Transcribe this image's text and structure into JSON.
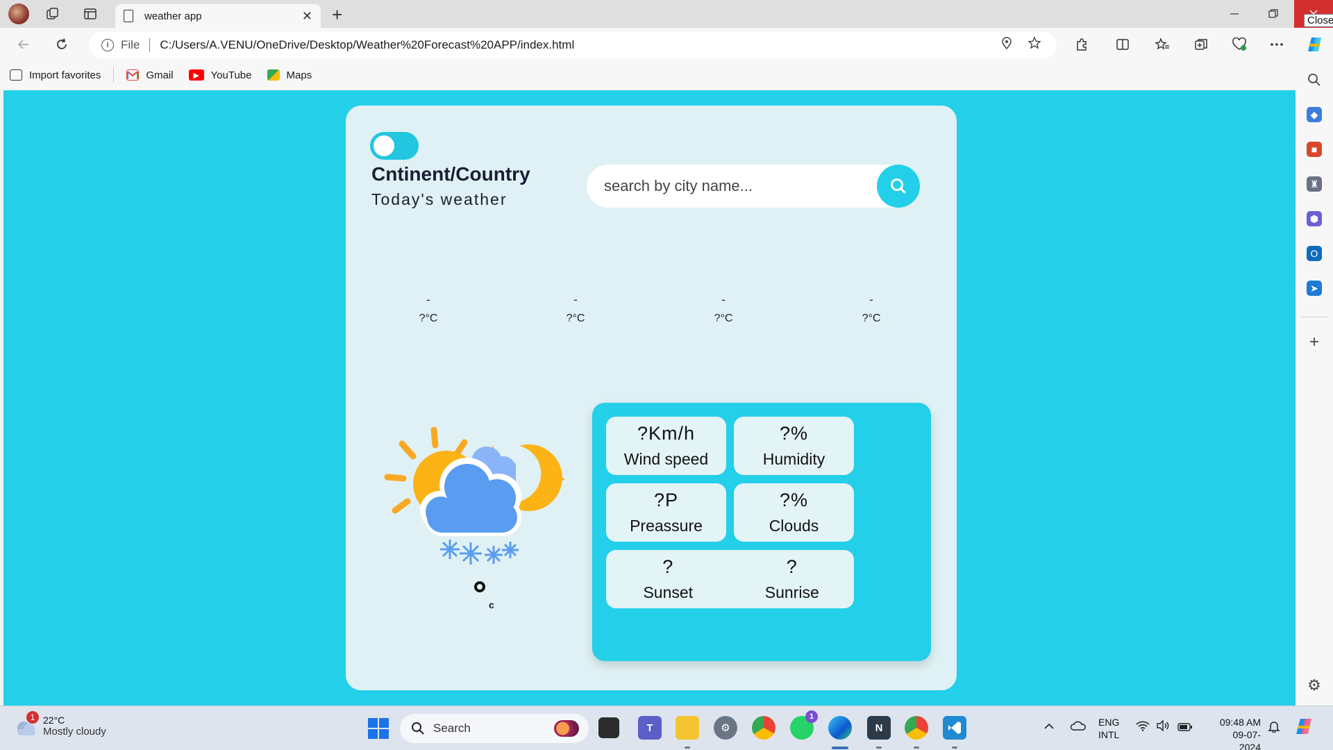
{
  "browser": {
    "tab_title": "weather app",
    "tab_close": "✕",
    "new_tab": "+",
    "file_label": "File",
    "url": "C:/Users/A.VENU/OneDrive/Desktop/Weather%20Forecast%20APP/index.html",
    "close_tooltip": "Close",
    "favorites": [
      {
        "label": "Import favorites",
        "icon": "import-icon"
      },
      {
        "label": "Gmail",
        "icon": "gmail-icon",
        "color": "#ea4335"
      },
      {
        "label": "YouTube",
        "icon": "youtube-icon",
        "color": "#ff0000"
      },
      {
        "label": "Maps",
        "icon": "maps-icon",
        "color": "#34a853"
      }
    ]
  },
  "app": {
    "place": "Cntinent/Country",
    "subtitle": "Today's weather",
    "search_placeholder": "search by city name...",
    "forecast": [
      {
        "time": "-",
        "temp": "?°C"
      },
      {
        "time": "-",
        "temp": "?°C"
      },
      {
        "time": "-",
        "temp": "?°C"
      },
      {
        "time": "-",
        "temp": "?°C"
      }
    ],
    "current_unit": "c",
    "details": {
      "wind": {
        "value": "?Km/h",
        "label": "Wind speed"
      },
      "humidity": {
        "value": "?%",
        "label": "Humidity"
      },
      "pressure": {
        "value": "?P",
        "label": "Preassure"
      },
      "clouds": {
        "value": "?%",
        "label": "Clouds"
      },
      "sunset": {
        "value": "?",
        "label": "Sunset"
      },
      "sunrise": {
        "value": "?",
        "label": "Sunrise"
      }
    },
    "colors": {
      "accent": "#23cfe9",
      "card": "#dff1f4"
    }
  },
  "taskbar": {
    "weather_temp": "22°C",
    "weather_desc": "Mostly cloudy",
    "weather_badge": "1",
    "search_label": "Search",
    "whatsapp_badge": "1",
    "lang_top": "ENG",
    "lang_bottom": "INTL",
    "time": "09:48 AM",
    "date": "09-07-2024"
  }
}
